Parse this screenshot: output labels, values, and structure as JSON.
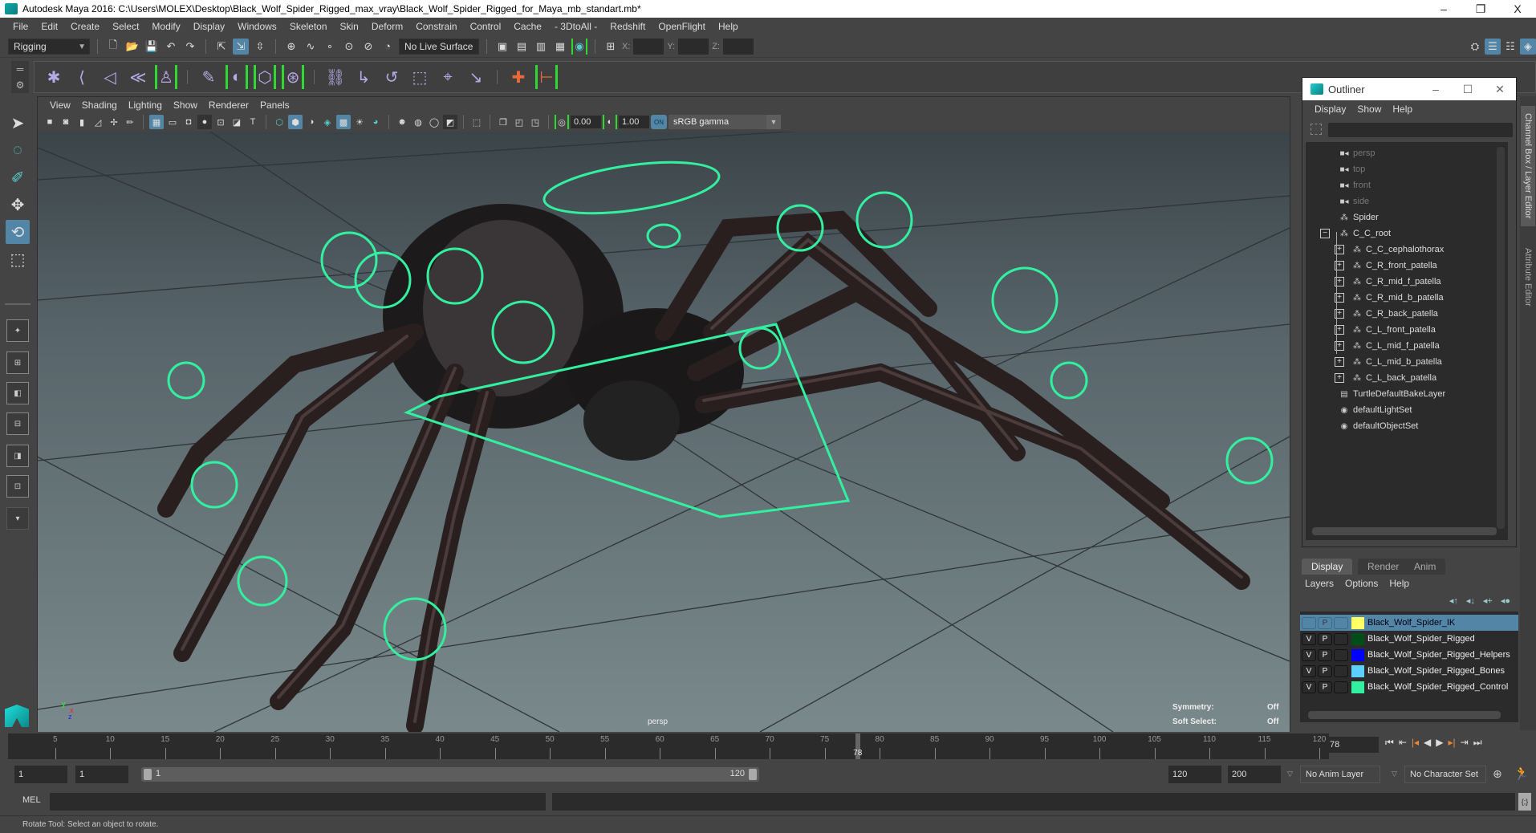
{
  "window": {
    "title": "Autodesk Maya 2016: C:\\Users\\MOLEX\\Desktop\\Black_Wolf_Spider_Rigged_max_vray\\Black_Wolf_Spider_Rigged_for_Maya_mb_standart.mb*",
    "minimize": "–",
    "restore": "❐",
    "close": "X"
  },
  "menubar": [
    "File",
    "Edit",
    "Create",
    "Select",
    "Modify",
    "Display",
    "Windows",
    "Skeleton",
    "Skin",
    "Deform",
    "Constrain",
    "Control",
    "Cache",
    "- 3DtoAll -",
    "Redshift",
    "OpenFlight",
    "Help"
  ],
  "statusline": {
    "menuset": "Rigging",
    "live_surface": "No Live Surface",
    "x_label": "X:",
    "y_label": "Y:",
    "z_label": "Z:"
  },
  "viewport": {
    "menu": [
      "View",
      "Shading",
      "Lighting",
      "Show",
      "Renderer",
      "Panels"
    ],
    "exposure": "0.00",
    "gamma": "1.00",
    "cm_toggle": "ON",
    "color_space": "sRGB gamma",
    "camera_label": "persp",
    "hud": {
      "symmetry_label": "Symmetry:",
      "symmetry_value": "Off",
      "soft_select_label": "Soft Select:",
      "soft_select_value": "Off"
    },
    "axis": {
      "x": "x",
      "y": "y",
      "z": "z"
    }
  },
  "outliner": {
    "title": "Outliner",
    "menu": [
      "Display",
      "Show",
      "Help"
    ],
    "search_value": "",
    "items": [
      {
        "label": "persp",
        "icon": "camera",
        "dim": true,
        "indent": 0
      },
      {
        "label": "top",
        "icon": "camera",
        "dim": true,
        "indent": 0
      },
      {
        "label": "front",
        "icon": "camera",
        "dim": true,
        "indent": 0
      },
      {
        "label": "side",
        "icon": "camera",
        "dim": true,
        "indent": 0
      },
      {
        "label": "Spider",
        "icon": "mesh",
        "dim": false,
        "indent": 0
      },
      {
        "label": "C_C_root",
        "icon": "mesh",
        "dim": false,
        "indent": 0,
        "expander": "−"
      },
      {
        "label": "C_C_cephalothorax",
        "icon": "mesh",
        "dim": false,
        "indent": 1,
        "expander": "+"
      },
      {
        "label": "C_R_front_patella",
        "icon": "mesh",
        "dim": false,
        "indent": 1,
        "expander": "+"
      },
      {
        "label": "C_R_mid_f_patella",
        "icon": "mesh",
        "dim": false,
        "indent": 1,
        "expander": "+"
      },
      {
        "label": "C_R_mid_b_patella",
        "icon": "mesh",
        "dim": false,
        "indent": 1,
        "expander": "+"
      },
      {
        "label": "C_R_back_patella",
        "icon": "mesh",
        "dim": false,
        "indent": 1,
        "expander": "+"
      },
      {
        "label": "C_L_front_patella",
        "icon": "mesh",
        "dim": false,
        "indent": 1,
        "expander": "+"
      },
      {
        "label": "C_L_mid_f_patella",
        "icon": "mesh",
        "dim": false,
        "indent": 1,
        "expander": "+"
      },
      {
        "label": "C_L_mid_b_patella",
        "icon": "mesh",
        "dim": false,
        "indent": 1,
        "expander": "+"
      },
      {
        "label": "C_L_back_patella",
        "icon": "mesh",
        "dim": false,
        "indent": 1,
        "expander": "+"
      },
      {
        "label": "TurtleDefaultBakeLayer",
        "icon": "layer",
        "dim": false,
        "indent": 0
      },
      {
        "label": "defaultLightSet",
        "icon": "set",
        "dim": false,
        "indent": 0
      },
      {
        "label": "defaultObjectSet",
        "icon": "set",
        "dim": false,
        "indent": 0
      }
    ]
  },
  "sidetabs": [
    "Channel Box / Layer Editor",
    "Attribute Editor"
  ],
  "layer_editor": {
    "tabs": [
      "Display",
      "Render",
      "Anim"
    ],
    "active_tab": "Display",
    "menu": [
      "Layers",
      "Options",
      "Help"
    ],
    "layers": [
      {
        "v": "",
        "p": "P",
        "color": "#ffff66",
        "name": "Black_Wolf_Spider_IK",
        "selected": true
      },
      {
        "v": "V",
        "p": "P",
        "color": "#004d1a",
        "name": "Black_Wolf_Spider_Rigged",
        "selected": false
      },
      {
        "v": "V",
        "p": "P",
        "color": "#0000ff",
        "name": "Black_Wolf_Spider_Rigged_Helpers",
        "selected": false
      },
      {
        "v": "V",
        "p": "P",
        "color": "#5ccfff",
        "name": "Black_Wolf_Spider_Rigged_Bones",
        "selected": false
      },
      {
        "v": "V",
        "p": "P",
        "color": "#33f0a0",
        "name": "Black_Wolf_Spider_Rigged_Control",
        "selected": false
      }
    ]
  },
  "timeline": {
    "start": 1,
    "end": 120,
    "tick_labels": [
      5,
      10,
      15,
      20,
      25,
      30,
      35,
      40,
      45,
      50,
      55,
      60,
      65,
      70,
      75,
      80,
      85,
      90,
      95,
      100,
      105,
      110,
      115,
      120
    ],
    "current_frame": "78"
  },
  "range": {
    "anim_start": "1",
    "playback_start": "1",
    "range_start_label": "1",
    "range_end_label": "120",
    "playback_end": "120",
    "anim_end": "200",
    "anim_layer": "No Anim Layer",
    "character_set": "No Character Set"
  },
  "command_line": {
    "label": "MEL",
    "value": "",
    "result": ""
  },
  "help_line": "Rotate Tool: Select an object to rotate."
}
